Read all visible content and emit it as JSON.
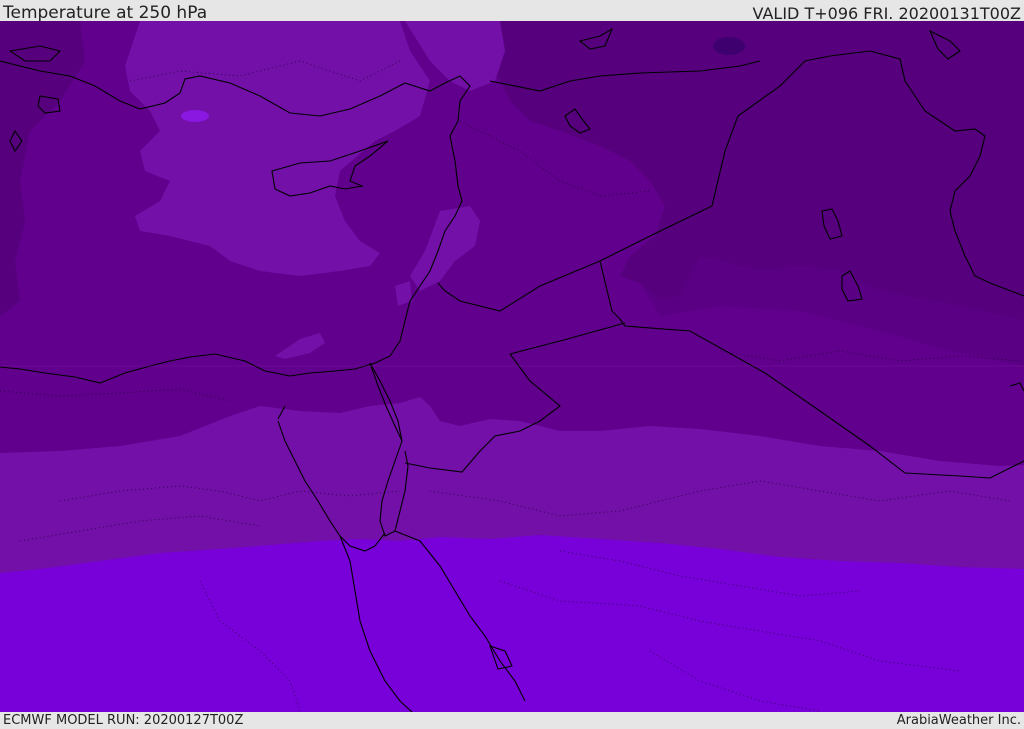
{
  "header": {
    "title": "Temperature at 250 hPa",
    "valid": "VALID T+096 FRI. 20200131T00Z"
  },
  "footer": {
    "model_run": "ECMWF MODEL RUN: 20200127T00Z",
    "credit": "ArabiaWeather Inc."
  },
  "map": {
    "fill_colors": {
      "darkest": "#3d006e",
      "darker": "#56007e",
      "dark": "#61008c",
      "mid": "#7210a8",
      "light": "#7800d8",
      "spot": "#8a18e0",
      "coast": "#000000"
    }
  }
}
